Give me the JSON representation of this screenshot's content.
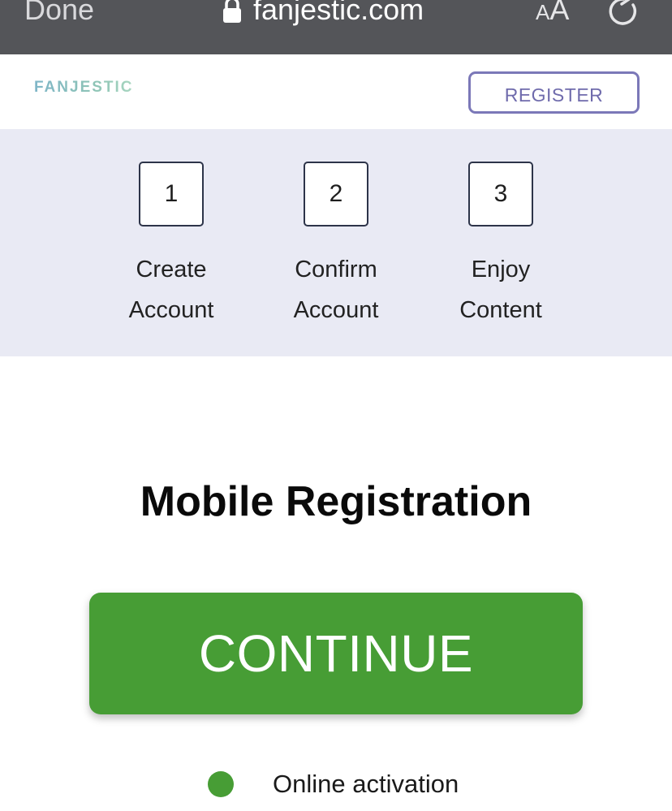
{
  "browser": {
    "done_label": "Done",
    "url": "fanjestic.com",
    "text_size_small": "A",
    "text_size_big": "A",
    "icons": [
      "lock-icon",
      "reload-icon"
    ]
  },
  "header": {
    "logo_text": "FANJESTIC",
    "register_label": "REGISTER",
    "register_border_color": "#7b78b8"
  },
  "steps": [
    {
      "number": "1",
      "line1": "Create",
      "line2": "Account"
    },
    {
      "number": "2",
      "line1": "Confirm",
      "line2": "Account"
    },
    {
      "number": "3",
      "line1": "Enjoy",
      "line2": "Content"
    }
  ],
  "main": {
    "title": "Mobile Registration",
    "continue_label": "CONTINUE",
    "continue_color": "#479d35",
    "activation_label": "Online activation",
    "status_color": "#479d35"
  }
}
